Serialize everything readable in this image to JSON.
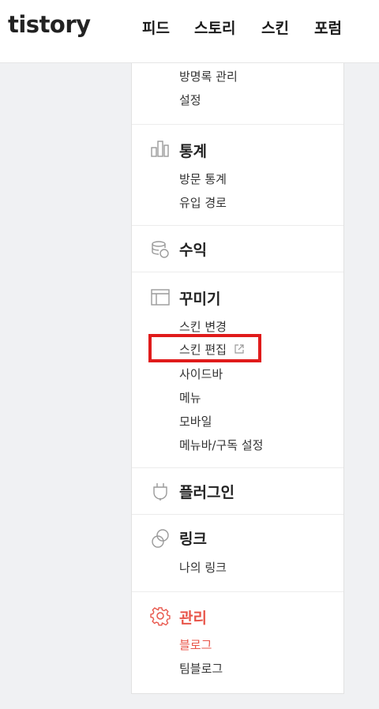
{
  "header": {
    "logo": "tistory",
    "nav": [
      "피드",
      "스토리",
      "스킨",
      "포럼"
    ]
  },
  "sections": {
    "top": {
      "items": [
        "방명록 관리",
        "설정"
      ]
    },
    "stats": {
      "title": "통계",
      "icon": "bar-chart-icon",
      "items": [
        "방문 통계",
        "유입 경로"
      ]
    },
    "revenue": {
      "title": "수익",
      "icon": "coins-icon"
    },
    "decor": {
      "title": "꾸미기",
      "icon": "layout-icon",
      "items": [
        "스킨 변경",
        "스킨 편집",
        "사이드바",
        "메뉴",
        "모바일",
        "메뉴바/구독 설정"
      ]
    },
    "plugin": {
      "title": "플러그인",
      "icon": "plug-icon"
    },
    "link": {
      "title": "링크",
      "icon": "link-icon",
      "items": [
        "나의 링크"
      ]
    },
    "manage": {
      "title": "관리",
      "icon": "gear-icon",
      "items": [
        "블로그",
        "팀블로그"
      ]
    }
  },
  "colors": {
    "accent": "#e8554a",
    "highlight": "#e01b1b"
  }
}
